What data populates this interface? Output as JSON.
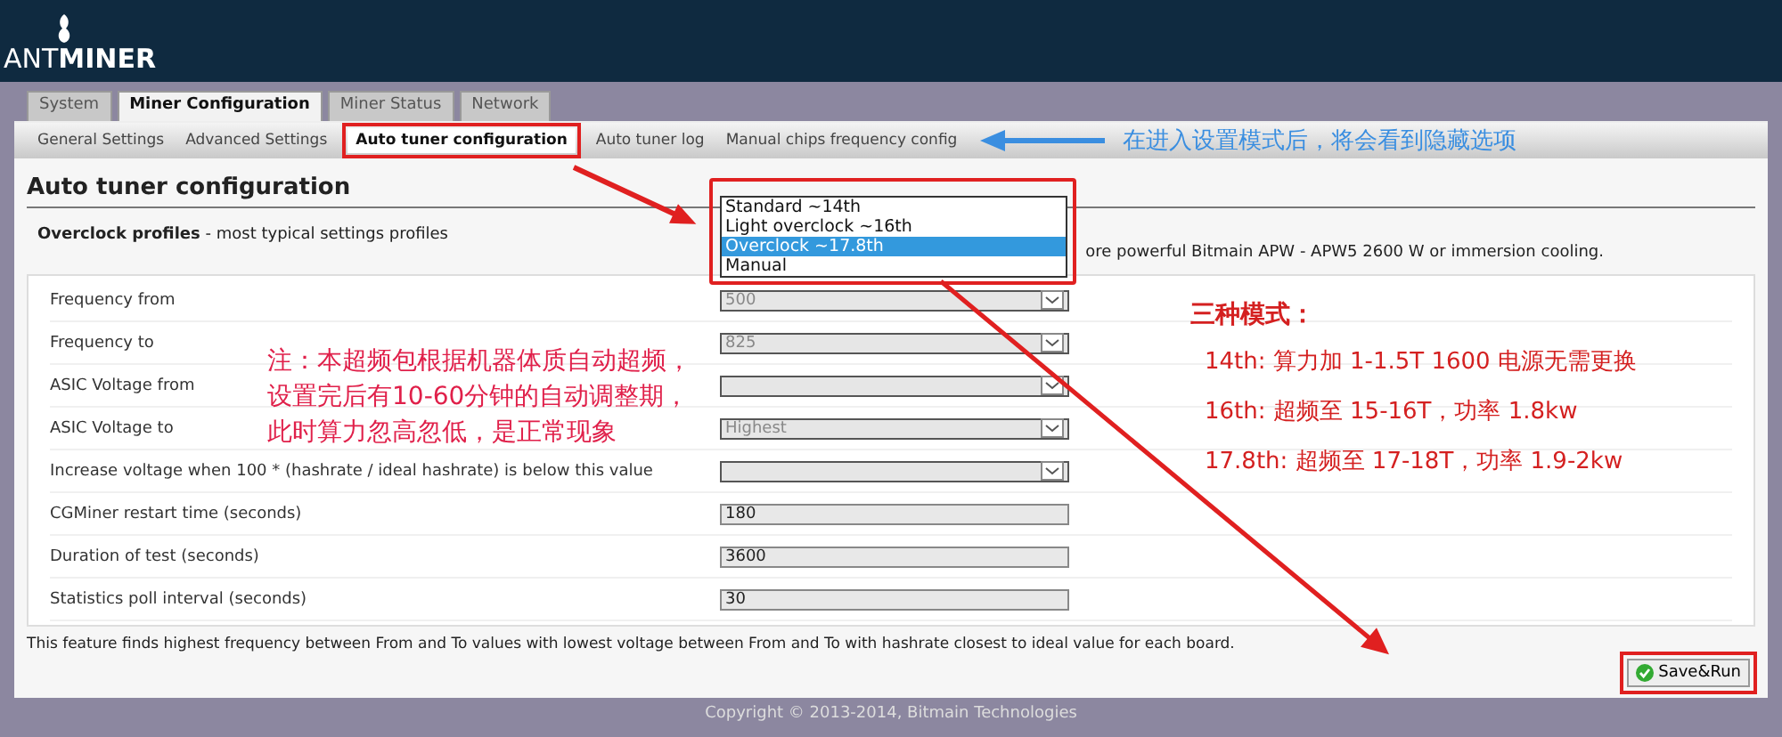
{
  "header": {
    "logo_light": "ANT",
    "logo_bold": "MINER"
  },
  "main_tabs": [
    {
      "label": "System",
      "selected": false
    },
    {
      "label": "Miner Configuration",
      "selected": true
    },
    {
      "label": "Miner Status",
      "selected": false
    },
    {
      "label": "Network",
      "selected": false
    }
  ],
  "sub_tabs": [
    {
      "label": "General Settings",
      "selected": false
    },
    {
      "label": "Advanced Settings",
      "selected": false
    },
    {
      "label": "Auto tuner configuration",
      "selected": true
    },
    {
      "label": "Auto tuner log",
      "selected": false
    },
    {
      "label": "Manual chips frequency config",
      "selected": false
    }
  ],
  "section_title": "Auto tuner configuration",
  "profiles": {
    "label": "Overclock profiles",
    "description": "- most typical settings profiles",
    "note_tail": "ore powerful Bitmain APW - APW5 2600 W or immersion cooling.",
    "options": [
      {
        "label": "Standard ~14th",
        "selected": false
      },
      {
        "label": "Light overclock ~16th",
        "selected": false
      },
      {
        "label": "Overclock ~17.8th",
        "selected": true
      },
      {
        "label": "Manual",
        "selected": false
      }
    ]
  },
  "settings": [
    {
      "kind": "select",
      "label": "Frequency from",
      "value": "500"
    },
    {
      "kind": "select",
      "label": "Frequency to",
      "value": "825"
    },
    {
      "kind": "select",
      "label": "ASIC Voltage from"
    },
    {
      "kind": "select",
      "label": "ASIC Voltage to",
      "value": "Highest"
    },
    {
      "kind": "select",
      "label": "Increase voltage when 100 * (hashrate / ideal hashrate) is below this value"
    },
    {
      "kind": "input",
      "label": "CGMiner restart time (seconds)",
      "value": "180"
    },
    {
      "kind": "input",
      "label": "Duration of test (seconds)",
      "value": "3600"
    },
    {
      "kind": "input",
      "label": "Statistics poll interval (seconds)",
      "value": "30"
    }
  ],
  "footnote": "This feature finds highest frequency between From and To values with lowest voltage between From and To with hashrate closest to ideal value for each board.",
  "save_button": "Save&Run",
  "copyright": "Copyright © 2013-2014, Bitmain Technologies",
  "annotations": {
    "tip": "在进入设置模式后，将会看到隐藏选项",
    "modes_title": "三种模式：",
    "modes": [
      "14th: 算力加 1-1.5T  1600 电源无需更换",
      "16th: 超频至 15-16T，功率 1.8kw",
      "17.8th: 超频至 17-18T，功率 1.9-2kw"
    ],
    "note_lines": [
      "注：本超频包根据机器体质自动超频，",
      "设置完后有10-60分钟的自动调整期，",
      "此时算力忽高忽低，是正常现象"
    ]
  }
}
